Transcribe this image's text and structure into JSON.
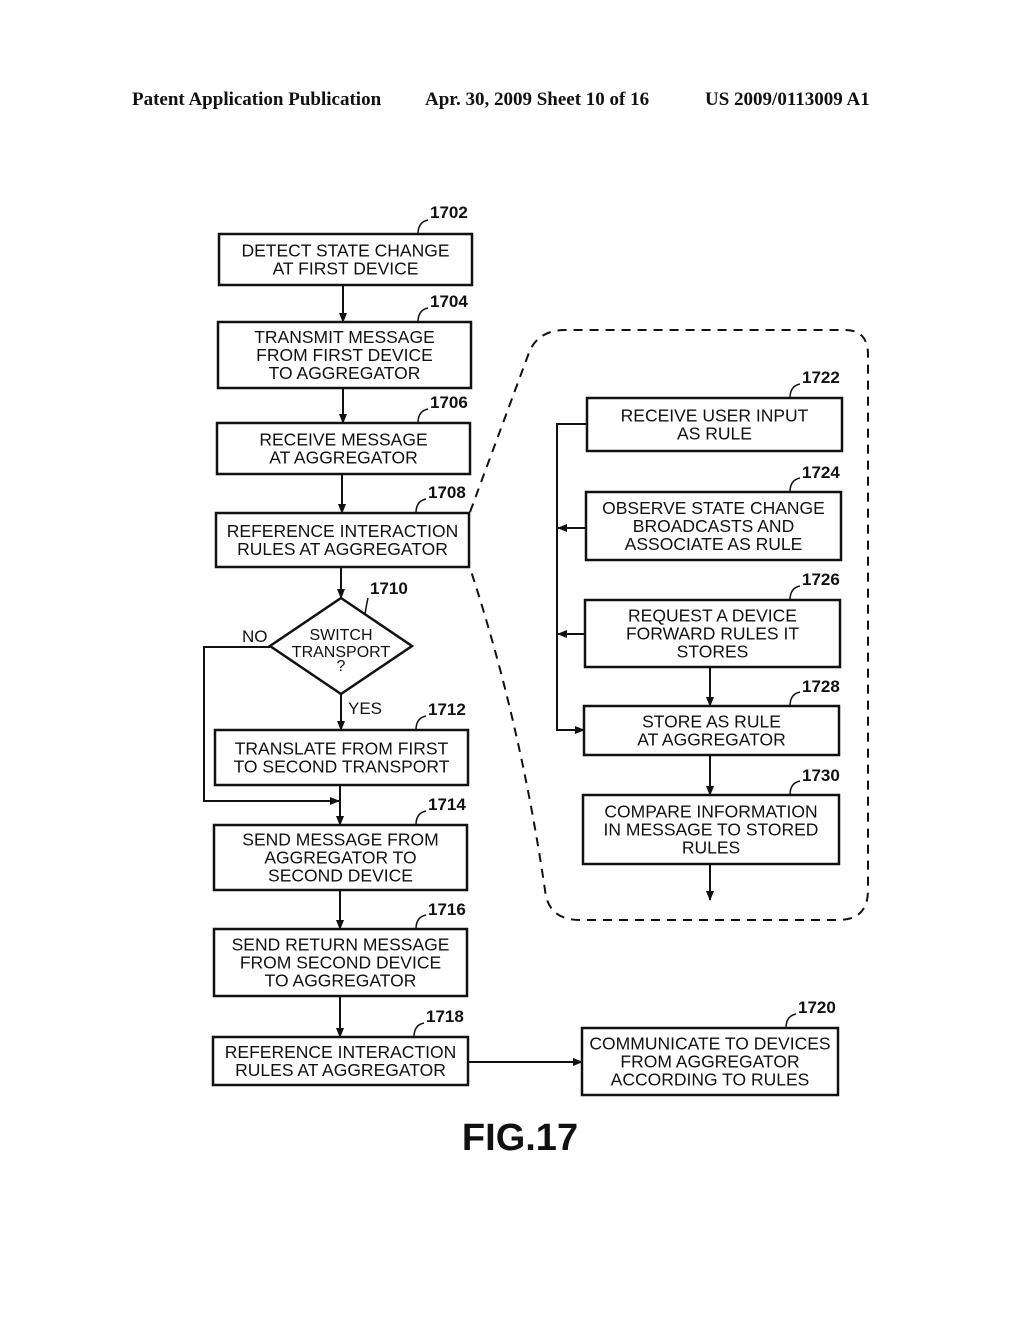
{
  "header": {
    "publication": "Patent Application Publication",
    "date_sheet": "Apr. 30, 2009  Sheet 10 of 16",
    "number": "US 2009/0113009 A1"
  },
  "figure_label": "FIG.17",
  "nodes": {
    "n1702": {
      "ref": "1702",
      "lines": [
        "DETECT STATE CHANGE",
        "AT FIRST DEVICE"
      ]
    },
    "n1704": {
      "ref": "1704",
      "lines": [
        "TRANSMIT MESSAGE",
        "FROM FIRST DEVICE",
        "TO AGGREGATOR"
      ]
    },
    "n1706": {
      "ref": "1706",
      "lines": [
        "RECEIVE MESSAGE",
        "AT AGGREGATOR"
      ]
    },
    "n1708": {
      "ref": "1708",
      "lines": [
        "REFERENCE INTERACTION",
        "RULES AT AGGREGATOR"
      ]
    },
    "n1710": {
      "ref": "1710",
      "lines": [
        "SWITCH",
        "TRANSPORT",
        "?"
      ]
    },
    "n1712": {
      "ref": "1712",
      "lines": [
        "TRANSLATE FROM FIRST",
        "TO SECOND TRANSPORT"
      ]
    },
    "n1714": {
      "ref": "1714",
      "lines": [
        "SEND MESSAGE FROM",
        "AGGREGATOR TO",
        "SECOND DEVICE"
      ]
    },
    "n1716": {
      "ref": "1716",
      "lines": [
        "SEND RETURN MESSAGE",
        "FROM SECOND DEVICE",
        "TO AGGREGATOR"
      ]
    },
    "n1718": {
      "ref": "1718",
      "lines": [
        "REFERENCE INTERACTION",
        "RULES AT AGGREGATOR"
      ]
    },
    "n1720": {
      "ref": "1720",
      "lines": [
        "COMMUNICATE TO DEVICES",
        "FROM AGGREGATOR",
        "ACCORDING TO RULES"
      ]
    },
    "n1722": {
      "ref": "1722",
      "lines": [
        "RECEIVE USER INPUT",
        "AS RULE"
      ]
    },
    "n1724": {
      "ref": "1724",
      "lines": [
        "OBSERVE STATE CHANGE",
        "BROADCASTS AND",
        "ASSOCIATE AS RULE"
      ]
    },
    "n1726": {
      "ref": "1726",
      "lines": [
        "REQUEST A DEVICE",
        "FORWARD RULES IT",
        "STORES"
      ]
    },
    "n1728": {
      "ref": "1728",
      "lines": [
        "STORE AS RULE",
        "AT AGGREGATOR"
      ]
    },
    "n1730": {
      "ref": "1730",
      "lines": [
        "COMPARE INFORMATION",
        "IN MESSAGE TO STORED",
        "RULES"
      ]
    }
  },
  "decision_labels": {
    "no": "NO",
    "yes": "YES"
  }
}
